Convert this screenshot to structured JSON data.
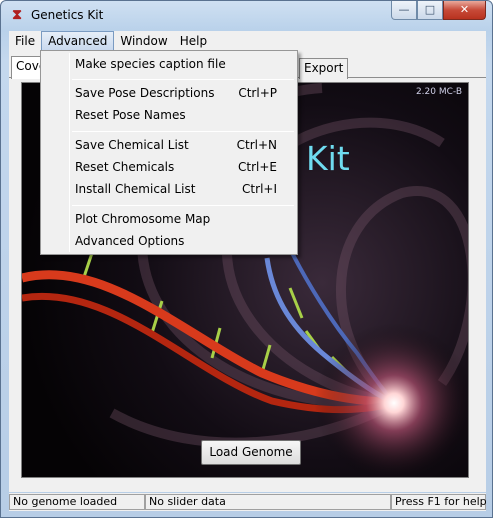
{
  "window": {
    "title": "Genetics Kit",
    "minimize_glyph": "—",
    "maximize_glyph": "□",
    "close_glyph": "✕"
  },
  "menubar": {
    "items": [
      "File",
      "Advanced",
      "Window",
      "Help"
    ]
  },
  "tabs": {
    "cover": "Cove",
    "export": "Export"
  },
  "splash": {
    "version": "2.20 MC-B",
    "title_fragment": "Kit",
    "load_button": "Load Genome"
  },
  "dropdown": {
    "items": [
      {
        "label": "Make species caption file",
        "shortcut": ""
      },
      {
        "label": "Save Pose Descriptions",
        "shortcut": "Ctrl+P"
      },
      {
        "label": "Reset Pose Names",
        "shortcut": ""
      },
      {
        "label": "Save Chemical List",
        "shortcut": "Ctrl+N"
      },
      {
        "label": "Reset Chemicals",
        "shortcut": "Ctrl+E"
      },
      {
        "label": "Install Chemical List",
        "shortcut": "Ctrl+I"
      },
      {
        "label": "Plot Chromosome Map",
        "shortcut": ""
      },
      {
        "label": "Advanced Options",
        "shortcut": ""
      }
    ]
  },
  "statusbar": {
    "genome": "No genome loaded",
    "slider": "No slider data",
    "help": "Press F1 for help"
  },
  "colors": {
    "title_accent": "#6fdcf0",
    "helix_red": "#d83a1c",
    "helix_blue": "#6a88d8"
  }
}
